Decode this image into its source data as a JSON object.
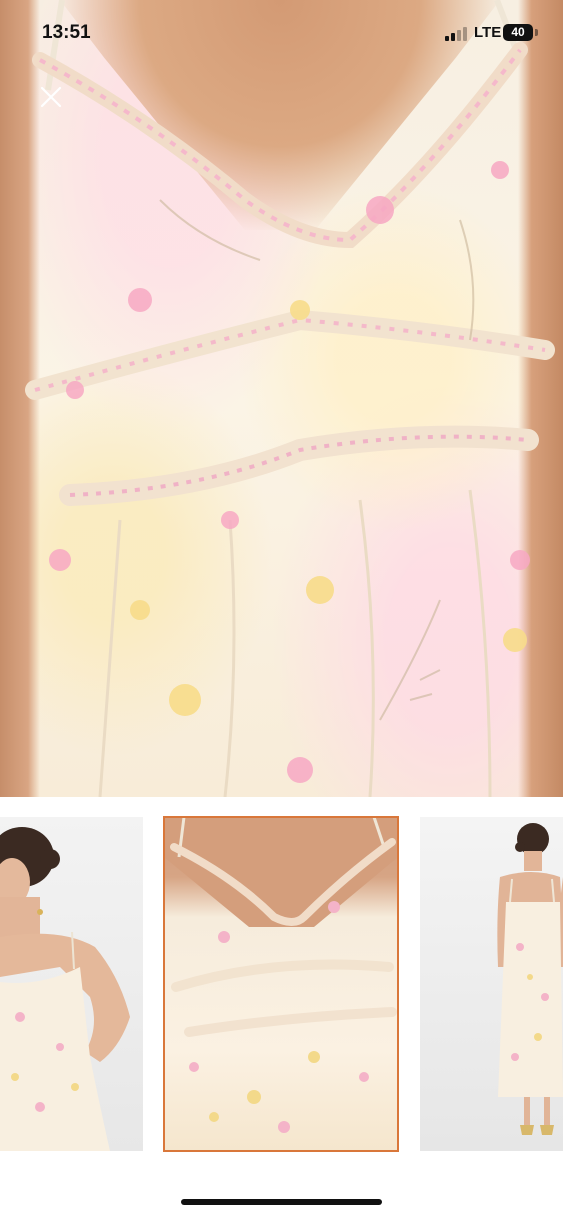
{
  "status_bar": {
    "time": "13:51",
    "network": "LTE",
    "battery": "40"
  },
  "icons": {
    "close": "close-icon",
    "signal": "cellular-signal-icon",
    "battery": "battery-icon"
  },
  "gallery": {
    "selected_index": 1,
    "thumbnails": [
      {
        "view": "model-front-side"
      },
      {
        "view": "dress-closeup"
      },
      {
        "view": "model-back"
      }
    ]
  },
  "colors": {
    "selected_outline": "#d9773a",
    "home_indicator": "#111111"
  }
}
